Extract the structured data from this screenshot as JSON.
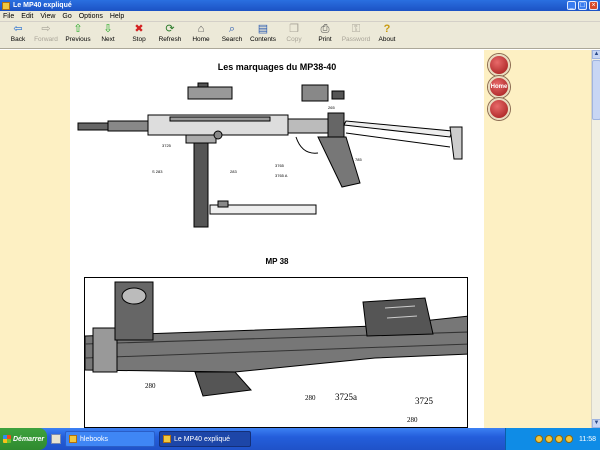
{
  "window": {
    "title": "Le MP40 expliqué",
    "controls": [
      "_",
      "□",
      "×"
    ]
  },
  "menu": [
    "File",
    "Edit",
    "View",
    "Go",
    "Options",
    "Help"
  ],
  "toolbar": [
    {
      "label": "Back",
      "icon": "back-arrow-icon",
      "glyph": "⇦",
      "color": "#1f6ad0",
      "enabled": true
    },
    {
      "label": "Forward",
      "icon": "forward-arrow-icon",
      "glyph": "⇨",
      "color": "#a8a498",
      "enabled": false
    },
    {
      "label": "Previous",
      "icon": "up-arrow-icon",
      "glyph": "⇧",
      "color": "#22a822",
      "enabled": true
    },
    {
      "label": "Next",
      "icon": "down-arrow-icon",
      "glyph": "⇩",
      "color": "#22a822",
      "enabled": true
    },
    {
      "label": "Stop",
      "icon": "stop-icon",
      "glyph": "✖",
      "color": "#d42020",
      "enabled": true
    },
    {
      "label": "Refresh",
      "icon": "refresh-icon",
      "glyph": "⟳",
      "color": "#2a7a2a",
      "enabled": true
    },
    {
      "label": "Home",
      "icon": "home-icon",
      "glyph": "⌂",
      "color": "#5a5a5a",
      "enabled": true
    },
    {
      "label": "Search",
      "icon": "search-icon",
      "glyph": "⌕",
      "color": "#2a5ab0",
      "enabled": true
    },
    {
      "label": "Contents",
      "icon": "contents-icon",
      "glyph": "▤",
      "color": "#2a5ab0",
      "enabled": true
    },
    {
      "label": "Copy",
      "icon": "copy-icon",
      "glyph": "❐",
      "color": "#a8a498",
      "enabled": false
    },
    {
      "label": "Print",
      "icon": "print-icon",
      "glyph": "⎙",
      "color": "#4a4a4a",
      "enabled": true
    },
    {
      "label": "Password",
      "icon": "password-icon",
      "glyph": "⚿",
      "color": "#a8a498",
      "enabled": false
    },
    {
      "label": "About",
      "icon": "about-icon",
      "glyph": "?",
      "color": "#c89a10",
      "enabled": true
    }
  ],
  "document": {
    "title": "Les marquages du MP38-40",
    "caption": "MP 38",
    "drawing_marks": [
      "3725",
      "S 283",
      "283",
      "3765",
      "3765 A",
      "785",
      "265"
    ],
    "detail_marks": [
      "280",
      "280",
      "3725a",
      "3725",
      "280"
    ]
  },
  "side_nav": [
    {
      "label": "",
      "icon": "back-circle-icon"
    },
    {
      "label": "Home",
      "icon": "home-circle-icon"
    },
    {
      "label": "",
      "icon": "next-circle-icon"
    }
  ],
  "taskbar": {
    "start_label": "Démarrer",
    "tasks": [
      {
        "label": "hlebooks",
        "active": false
      },
      {
        "label": "Le MP40 expliqué",
        "active": true
      }
    ],
    "clock": "11:58"
  }
}
